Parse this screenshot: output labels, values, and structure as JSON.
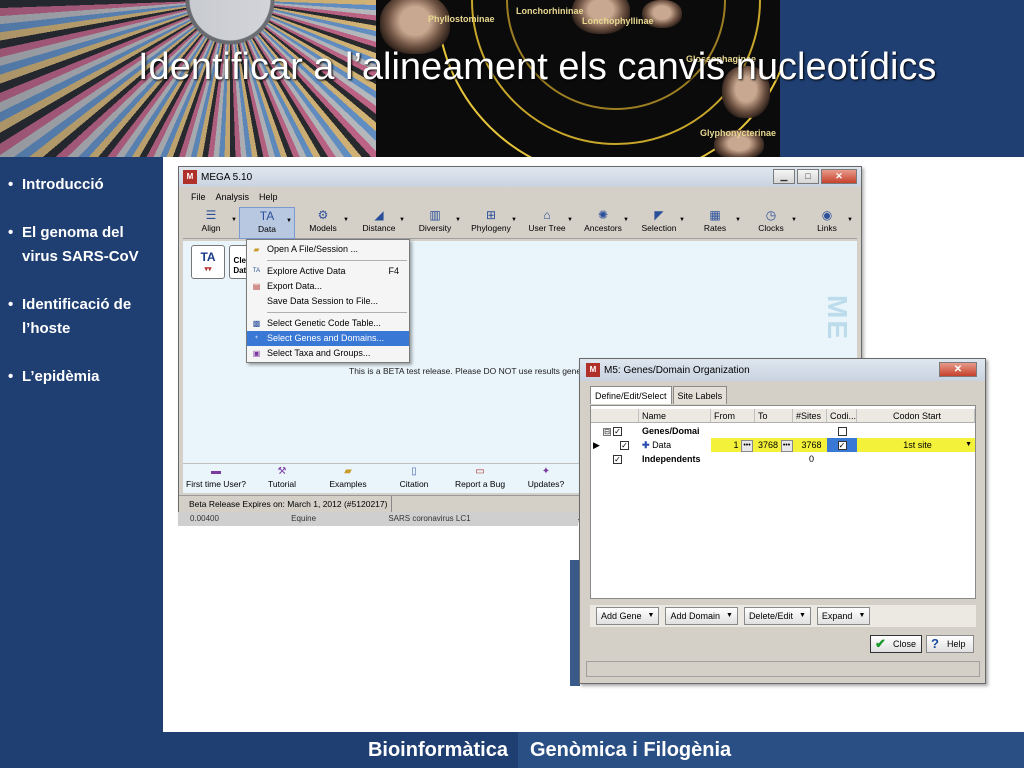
{
  "slide": {
    "title": "Identificar a l’alineament els canvis nucleotídics",
    "clades": [
      "Phyllostominae",
      "Lonchorhininae",
      "Lonchophyllinae",
      "Glossophaginae",
      "Glyphonycterinae"
    ]
  },
  "sidebar": {
    "items": [
      {
        "label": "Introducció"
      },
      {
        "label": "El genoma del\nvirus SARS-CoV"
      },
      {
        "label": "Identificació de\nl’hoste"
      },
      {
        "label": "L’epidèmia"
      }
    ]
  },
  "footer": {
    "left": "Bioinformàtica",
    "right": "Genòmica i Filogènia"
  },
  "mega": {
    "title": "MEGA 5.10",
    "menu": [
      "File",
      "Analysis",
      "Help"
    ],
    "toolbar": [
      {
        "label": "Align",
        "icon": "align-icon",
        "glyph": "☰"
      },
      {
        "label": "Data",
        "icon": "data-icon",
        "glyph": "TA"
      },
      {
        "label": "Models",
        "icon": "models-icon",
        "glyph": "⚙"
      },
      {
        "label": "Distance",
        "icon": "distance-icon",
        "glyph": "◢"
      },
      {
        "label": "Diversity",
        "icon": "diversity-icon",
        "glyph": "▥"
      },
      {
        "label": "Phylogeny",
        "icon": "phylogeny-icon",
        "glyph": "⊞"
      },
      {
        "label": "User Tree",
        "icon": "user-tree-icon",
        "glyph": "⌂"
      },
      {
        "label": "Ancestors",
        "icon": "ancestors-icon",
        "glyph": "✺"
      },
      {
        "label": "Selection",
        "icon": "selection-icon",
        "glyph": "◤"
      },
      {
        "label": "Rates",
        "icon": "rates-icon",
        "glyph": "▦"
      },
      {
        "label": "Clocks",
        "icon": "clocks-icon",
        "glyph": "◷"
      },
      {
        "label": "Links",
        "icon": "links-icon",
        "glyph": "◉"
      }
    ],
    "big_buttons": {
      "ta": "TA",
      "clear_data": "Clea Data"
    },
    "watermark": "ME",
    "beta_note": "This is a BETA test release. Please DO NOT use results gene",
    "bottom_tools": [
      "First time User?",
      "Tutorial",
      "Examples",
      "Citation",
      "Report a Bug",
      "Updates?"
    ],
    "status": "Beta Release Expires on: March 1, 2012 (#5120217)",
    "background_strip": [
      "0.00400",
      "Equine",
      "SARS coronavirus LC1"
    ]
  },
  "dropdown": [
    {
      "label": "Open A File/Session ...",
      "key": "",
      "icon": "open-folder-icon",
      "glyph": "▰"
    },
    {
      "sep": true
    },
    {
      "label": "Explore Active Data",
      "key": "F4",
      "icon": "explore-data-icon",
      "glyph": "TA"
    },
    {
      "label": "Export Data...",
      "key": "",
      "icon": "export-data-icon",
      "glyph": "▤"
    },
    {
      "label": "Save Data Session to File...",
      "key": "",
      "icon": "",
      "glyph": ""
    },
    {
      "sep": true
    },
    {
      "label": "Select Genetic Code Table...",
      "key": "",
      "icon": "genetic-code-icon",
      "glyph": "▩"
    },
    {
      "label": "Select Genes and Domains...",
      "key": "",
      "icon": "genes-domains-icon",
      "glyph": "⁺",
      "selected": true
    },
    {
      "label": "Select Taxa and Groups...",
      "key": "",
      "icon": "taxa-groups-icon",
      "glyph": "▣"
    }
  ],
  "dialog": {
    "title": "M5: Genes/Domain Organization",
    "tabs": [
      "Define/Edit/Select",
      "Site Labels"
    ],
    "columns": [
      "Name",
      "From",
      "To",
      "#Sites",
      "Codi...",
      "Codon Start"
    ],
    "rows": [
      {
        "tree": "⊟",
        "name": "Genes/Domai",
        "bold": true,
        "from": "",
        "to": "",
        "sites": "",
        "coding": "",
        "codon_start": ""
      },
      {
        "tree": "",
        "name": "Data",
        "bold": false,
        "from": "1",
        "to": "3768",
        "sites": "3768",
        "coding": "✓",
        "codon_start": "1st site"
      },
      {
        "tree": "",
        "name": "Independents",
        "bold": true,
        "from": "",
        "to": "",
        "sites": "0",
        "coding": "",
        "codon_start": ""
      }
    ],
    "buttons": [
      "Add Gene",
      "Add Domain",
      "Delete/Edit",
      "Expand"
    ],
    "close_label": "Close",
    "help_label": "Help"
  }
}
